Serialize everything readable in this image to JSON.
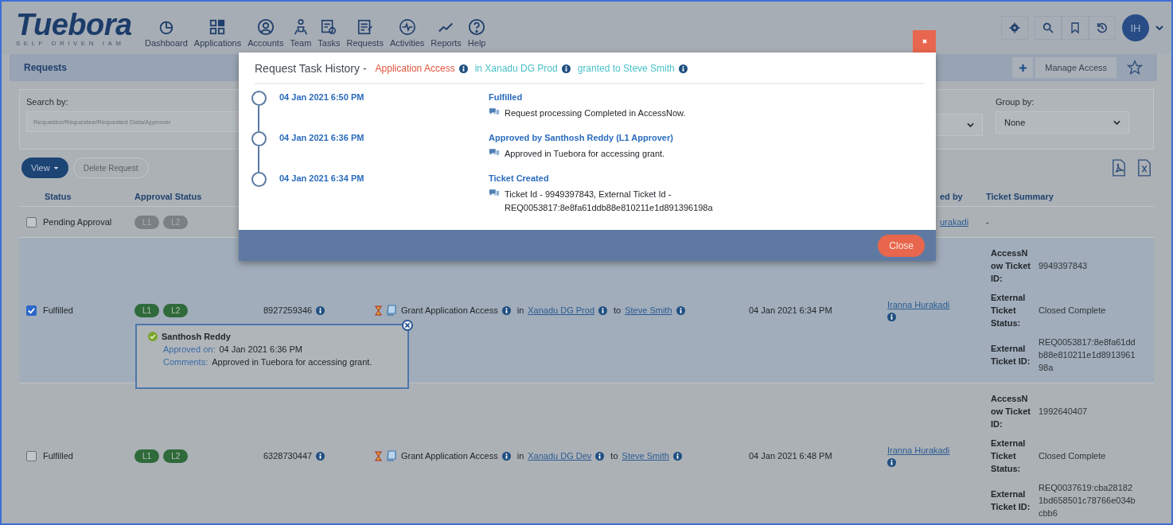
{
  "app": {
    "logo": "Tuebora",
    "tagline": "SELF DRIVEN IAM",
    "avatar": "IH",
    "nav": [
      {
        "label": "Dashboard"
      },
      {
        "label": "Applications"
      },
      {
        "label": "Accounts"
      },
      {
        "label": "Team"
      },
      {
        "label": "Tasks"
      },
      {
        "label": "Requests"
      },
      {
        "label": "Activities"
      },
      {
        "label": "Reports"
      },
      {
        "label": "Help"
      }
    ]
  },
  "page": {
    "title": "Requests",
    "action": "Manage Access"
  },
  "filters": {
    "search_label": "Search by:",
    "search_placeholder": "Requestor/Requestee/Requested Data/Approver",
    "group_label": "Group by:",
    "group_value": "None"
  },
  "toolbar": {
    "view": "View",
    "delete": "Delete Request",
    "delete_disabled": true
  },
  "table": {
    "columns": [
      {
        "label": "Status"
      },
      {
        "label": "Approval Status"
      },
      {
        "label": "ed by"
      },
      {
        "label": "Ticket Summary"
      }
    ],
    "rows": [
      {
        "kind": "pending",
        "checked": false,
        "status": "Pending Approval",
        "approvals": [
          {
            "label": "L1",
            "approved": false
          },
          {
            "label": "L2",
            "approved": false
          }
        ],
        "requested_by": "urakadi",
        "ticket_summary": "-"
      },
      {
        "kind": "full",
        "checked": true,
        "status": "Fulfilled",
        "approvals": [
          {
            "label": "L1",
            "approved": true
          },
          {
            "label": "L2",
            "approved": true
          }
        ],
        "request_id": "8927259346",
        "request": "Grant Application Access",
        "in_word": "in",
        "target": "Xanadu DG Prod",
        "to_word": "to",
        "user": "Steve Smith",
        "date": "04 Jan 2021 6:34 PM",
        "requested_by": "Iranna Hurakadi",
        "ticket": [
          {
            "label": "AccessNow Ticket ID:",
            "value": "9949397843"
          },
          {
            "label": "External Ticket Status:",
            "value": "Closed Complete"
          },
          {
            "label": "External Ticket ID:",
            "value": "REQ0053817:8e8fa61ddb88e810211e1d891396198a"
          }
        ]
      },
      {
        "kind": "full",
        "checked": false,
        "status": "Fulfilled",
        "approvals": [
          {
            "label": "L1",
            "approved": true
          },
          {
            "label": "L2",
            "approved": true
          }
        ],
        "request_id": "6328730447",
        "request": "Grant Application Access",
        "in_word": "in",
        "target": "Xanadu DG Dev",
        "to_word": "to",
        "user": "Steve Smith",
        "date": "04 Jan 2021 6:48 PM",
        "requested_by": "Iranna Hurakadi",
        "ticket": [
          {
            "label": "AccessNow Ticket ID:",
            "value": "1992640407"
          },
          {
            "label": "External Ticket Status:",
            "value": "Closed Complete"
          },
          {
            "label": "External Ticket ID:",
            "value": "REQ0037619:cba281821bd658501c78766e034bcbb6"
          }
        ]
      }
    ]
  },
  "approval_popover": {
    "name": "Santhosh Reddy",
    "approved_label": "Approved on:",
    "approved_value": "04 Jan 2021 6:36 PM",
    "comments_label": "Comments:",
    "comments_value": "Approved in Tuebora for accessing grant."
  },
  "modal": {
    "title": "Request Task History -",
    "tags": [
      {
        "text": "Application Access",
        "color": "#e2543c"
      },
      {
        "text": "in Xanadu DG Prod",
        "color": "#48c1c8"
      },
      {
        "text": "granted to Steve Smith",
        "color": "#48c1c8"
      }
    ],
    "events": [
      {
        "time": "04 Jan 2021 6:50 PM",
        "title": "Fulfilled",
        "note": "Request processing Completed in AccessNow."
      },
      {
        "time": "04 Jan 2021 6:36 PM",
        "title": "Approved by Santhosh Reddy (L1 Approver)",
        "note": "Approved in Tuebora for accessing grant."
      },
      {
        "time": "04 Jan 2021 6:34 PM",
        "title": "Ticket Created",
        "note": "Ticket Id - 9949397843, External Ticket Id - REQ0053817:8e8fa61ddb88e810211e1d891396198a"
      }
    ],
    "close": "Close"
  }
}
